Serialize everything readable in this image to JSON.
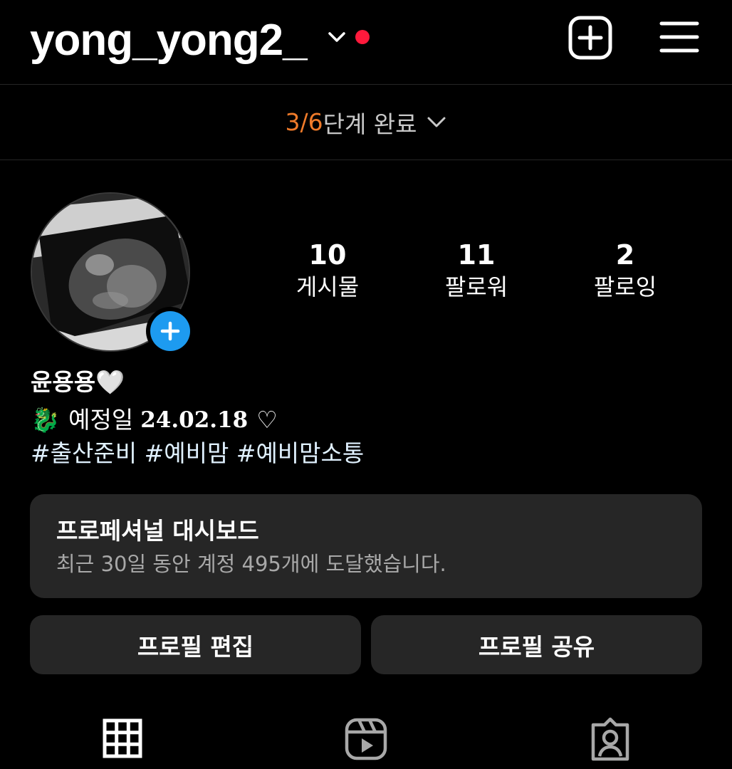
{
  "header": {
    "username": "yong_yong2_",
    "has_notification": true,
    "icons": [
      "chevron-down-icon",
      "create-post-icon",
      "menu-icon"
    ]
  },
  "steps": {
    "progress": "3/6",
    "label": "단계 완료"
  },
  "profile": {
    "stats": [
      {
        "value": "10",
        "label": "게시물"
      },
      {
        "value": "11",
        "label": "팔로워"
      },
      {
        "value": "2",
        "label": "팔로잉"
      }
    ],
    "bio": {
      "name": "윤용용",
      "name_emoji": "🤍",
      "line_emoji": "🐉",
      "line_text": "예정일",
      "line_date": "24.02.18",
      "line_suffix": "♡",
      "hashtags": "#출산준비 #예비맘 #예비맘소통"
    }
  },
  "dashboard": {
    "title": "프로페셔널 대시보드",
    "subtitle": "최근 30일 동안 계정 495개에 도달했습니다."
  },
  "actions": {
    "edit_label": "프로필 편집",
    "share_label": "프로필 공유"
  },
  "tabs": [
    "grid-icon",
    "reels-icon",
    "tagged-icon"
  ],
  "colors": {
    "background": "#000000",
    "surface": "#262626",
    "accent_orange": "#f07b2a",
    "accent_blue": "#1d9bf0",
    "notification_red": "#ff1a3c"
  }
}
